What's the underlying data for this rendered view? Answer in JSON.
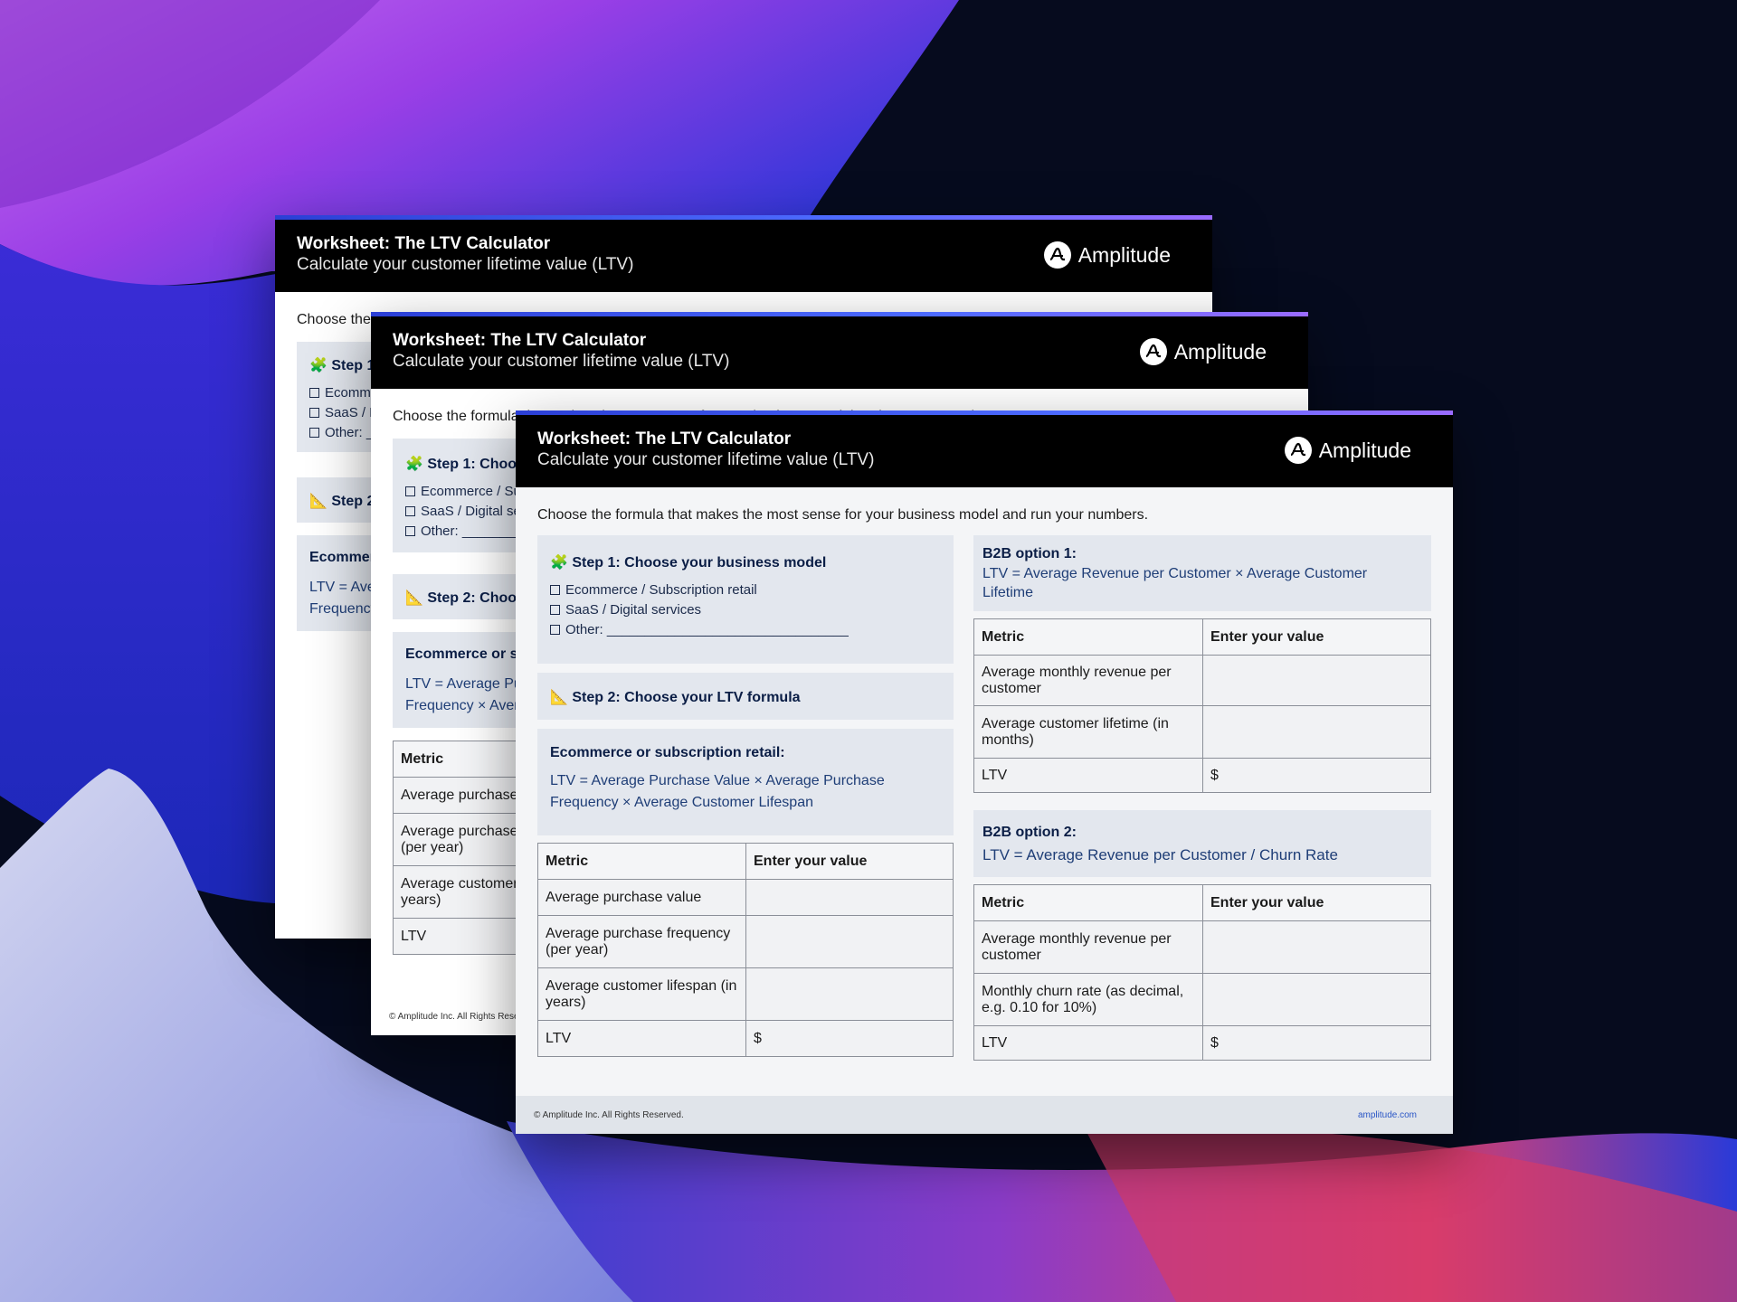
{
  "worksheet": {
    "title": "Worksheet: The LTV Calculator",
    "subtitle": "Calculate your customer lifetime value (LTV)",
    "brand": "Amplitude",
    "intro": "Choose the formula that makes the most sense for your business model and run your numbers.",
    "step1": {
      "title": "Step 1: Choose your business model",
      "icon": "puzzle-icon",
      "options": [
        "Ecommerce / Subscription retail",
        "SaaS / Digital services",
        "Other: ________________________________"
      ]
    },
    "step2": {
      "title": "Step 2: Choose your LTV formula",
      "icon": "ruler-icon"
    },
    "ecommerce": {
      "title": "Ecommerce or subscription retail:",
      "formula": "LTV = Average Purchase Value × Average Purchase Frequency × Average Customer Lifespan"
    },
    "table_headers": [
      "Metric",
      "Enter your value"
    ],
    "ecom_rows": [
      [
        "Average purchase value",
        ""
      ],
      [
        "Average purchase frequency (per year)",
        ""
      ],
      [
        "Average customer lifespan (in years)",
        ""
      ],
      [
        "LTV",
        "$"
      ]
    ],
    "b2b1": {
      "title": "B2B option 1:",
      "formula": "LTV = Average Revenue per Customer × Average Customer Lifetime"
    },
    "b2b1_rows": [
      [
        "Average monthly revenue per customer",
        ""
      ],
      [
        "Average customer lifetime (in months)",
        ""
      ],
      [
        "LTV",
        "$"
      ]
    ],
    "b2b2": {
      "title": "B2B option 2:",
      "formula": "LTV = Average Revenue per Customer / Churn Rate"
    },
    "b2b2_rows": [
      [
        "Average monthly revenue per customer",
        ""
      ],
      [
        "Monthly churn rate (as decimal, e.g. 0.10 for 10%)",
        ""
      ],
      [
        "LTV",
        "$"
      ]
    ],
    "footer": {
      "copyright": "© Amplitude Inc.  All Rights Reserved.",
      "site": "amplitude.com"
    }
  },
  "colors": {
    "accent": "#2b3fd6",
    "header": "#000000",
    "box": "#e3e7ee",
    "link": "#2a56c6"
  }
}
